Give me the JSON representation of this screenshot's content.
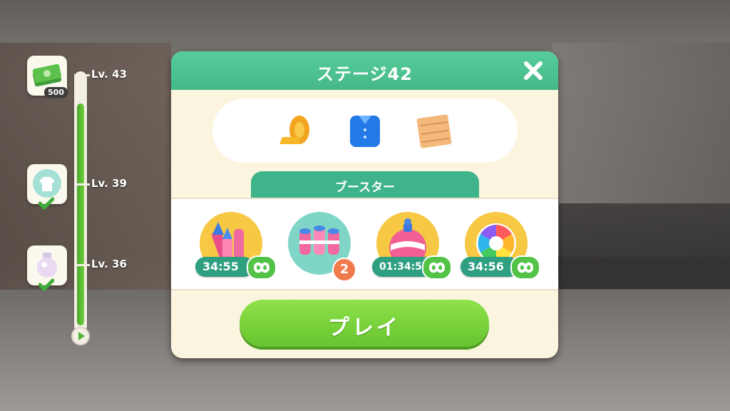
{
  "progress": {
    "fill_fraction": 0.9,
    "levels": [
      "Lv. 43",
      "Lv. 39",
      "Lv. 36"
    ],
    "rewards": [
      {
        "icon": "cash-stack-icon",
        "amount": "500",
        "completed": false
      },
      {
        "icon": "shirt-hanger-icon",
        "completed": true
      },
      {
        "icon": "perfume-bottle-icon",
        "completed": true
      }
    ]
  },
  "dialog": {
    "title": "ステージ42",
    "items": [
      "measuring-tape-icon",
      "blue-shirt-icon",
      "wooden-plank-icon"
    ],
    "booster_tab": "ブースター",
    "boosters": [
      {
        "icon": "fireworks-booster-icon",
        "timer": "34:55",
        "infinite": true
      },
      {
        "icon": "dynamite-pack-booster-icon",
        "count": "2"
      },
      {
        "icon": "bomb-booster-icon",
        "timer": "01:34:55",
        "infinite": true
      },
      {
        "icon": "color-wheel-booster-icon",
        "timer": "34:56",
        "infinite": true
      }
    ],
    "play_label": "プレイ"
  },
  "colors": {
    "header": "#45b886",
    "play": "#66c42f",
    "panel": "#fbf5df",
    "timer": "#2f9f82",
    "count_badge": "#f07a4a"
  }
}
